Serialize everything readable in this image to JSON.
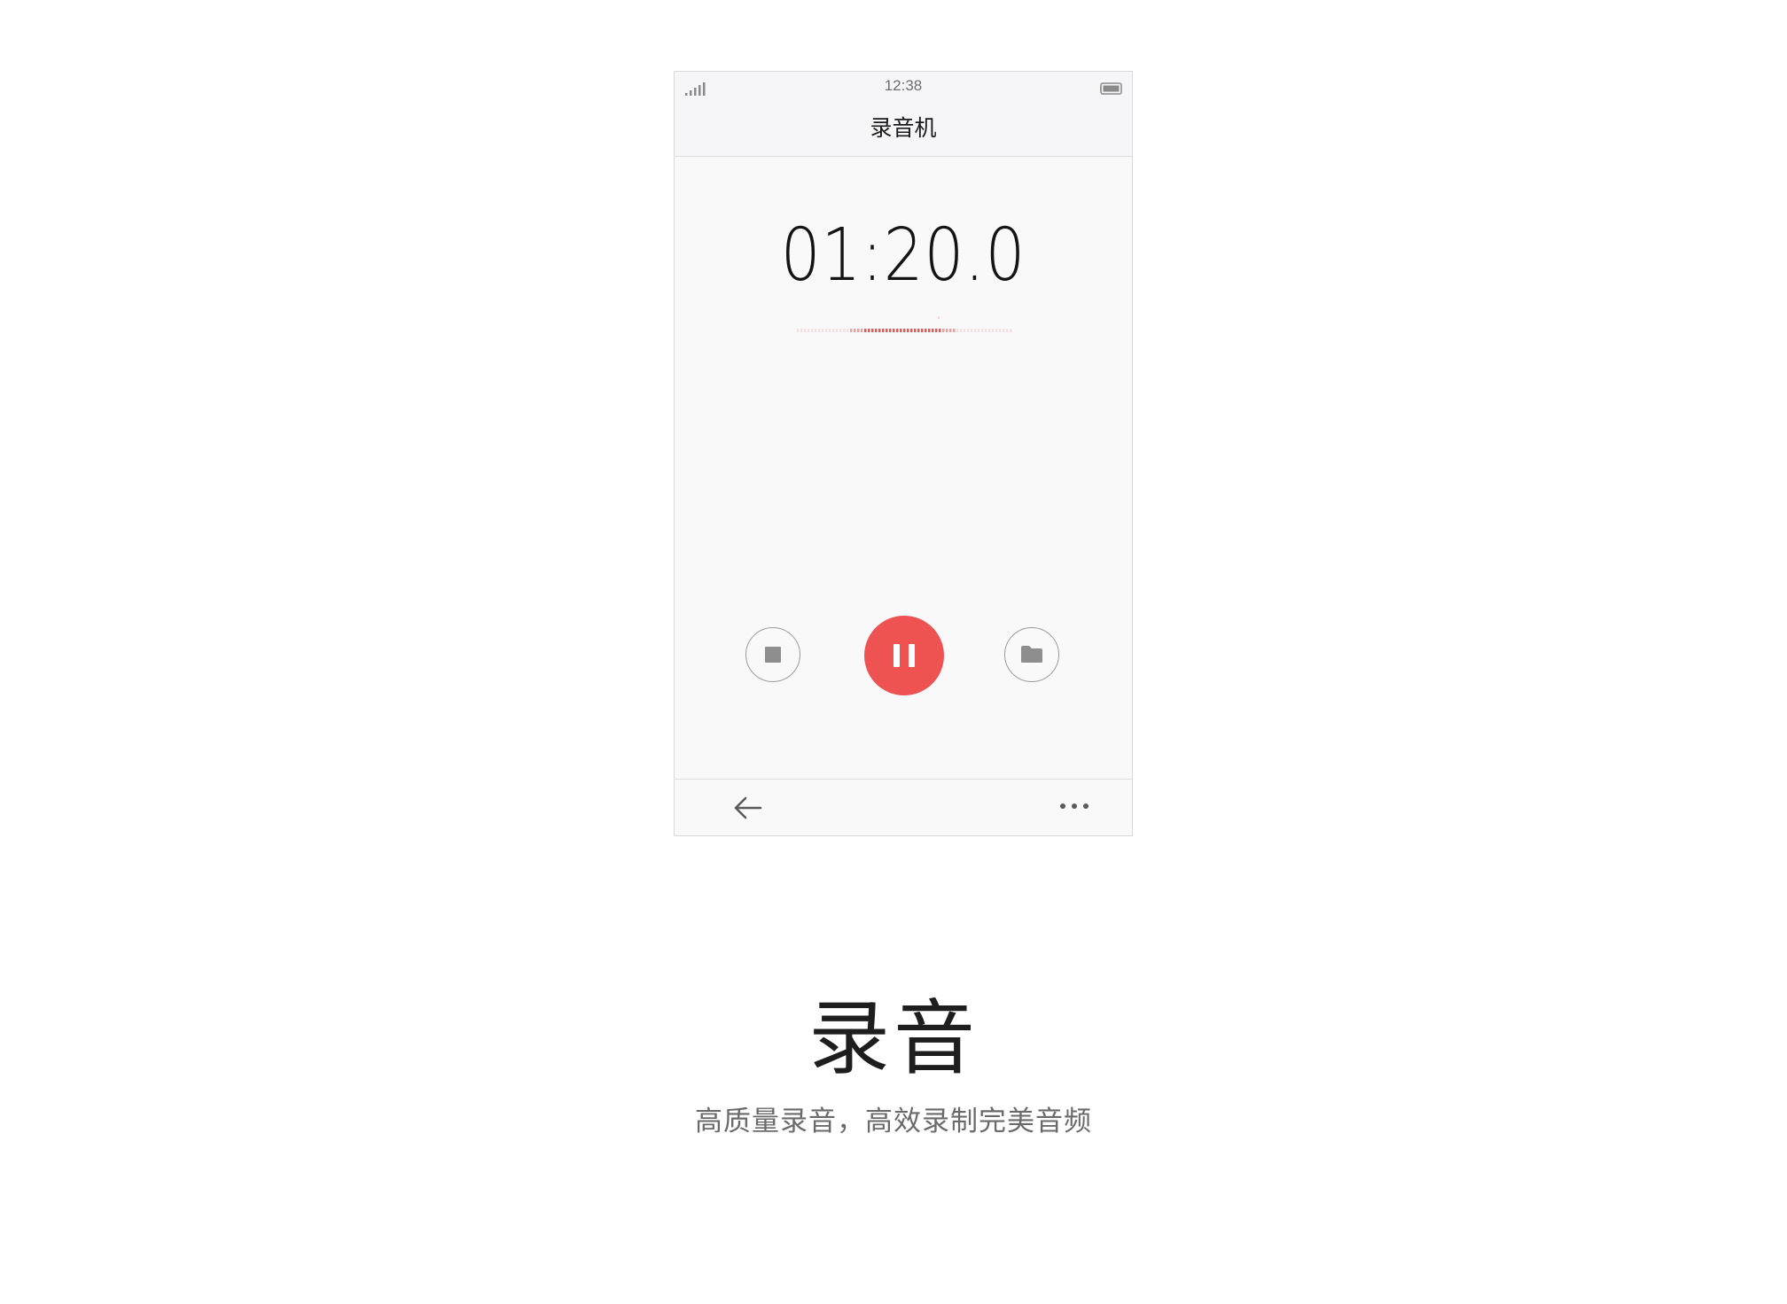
{
  "status_bar": {
    "time": "12:38",
    "signal_icon": "signal-strength-icon",
    "battery_icon": "battery-icon"
  },
  "app": {
    "title": "录音机"
  },
  "recorder": {
    "elapsed": "01:20.0",
    "accent_color": "#ee5352",
    "stop_icon": "stop-icon",
    "pause_icon": "pause-icon",
    "folder_icon": "folder-icon"
  },
  "bottom_bar": {
    "back_icon": "back-arrow-icon",
    "more_icon": "more-dots-icon"
  },
  "caption": {
    "title": "录音",
    "subtitle": "高质量录音，高效录制完美音频"
  }
}
